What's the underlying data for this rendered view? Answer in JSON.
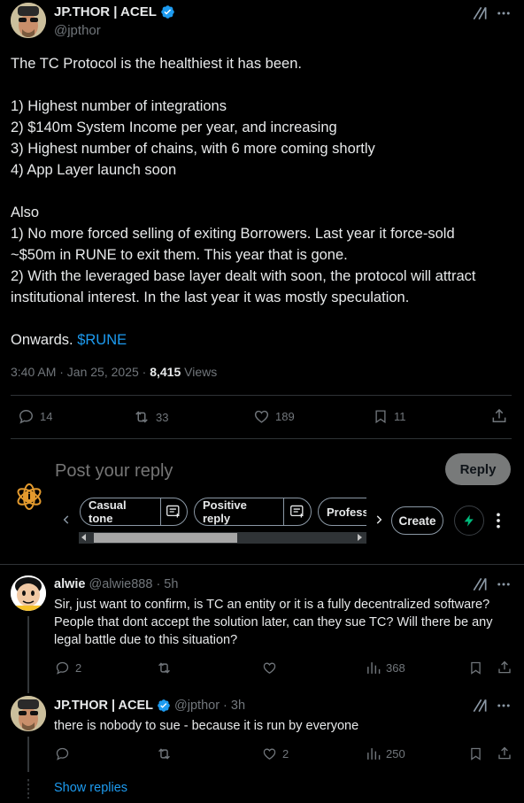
{
  "main_tweet": {
    "display_name": "JP.THOR | ACEL",
    "handle": "@jpthor",
    "lines": [
      "The TC Protocol is the healthiest it has been.",
      "",
      "1) Highest number of integrations",
      "2) $140m System Income per year, and increasing",
      "3) Highest number of chains, with 6 more coming shortly",
      "4) App Layer launch soon",
      "",
      "Also",
      "1) No more forced selling of exiting Borrowers. Last year it force-sold",
      "~$50m in RUNE to exit them. This year that is gone.",
      "2) With the leveraged base layer dealt with soon, the protocol will attract",
      "institutional interest. In the last year it was mostly speculation.",
      ""
    ],
    "final_line_prefix": "Onwards. ",
    "cashtag": "$RUNE",
    "timestamp": "3:40 AM · Jan 25, 2025 · ",
    "views_count": "8,415",
    "views_label": " Views",
    "replies": "14",
    "reposts": "33",
    "likes": "189",
    "bookmarks": "11"
  },
  "composer": {
    "placeholder": "Post your reply",
    "reply_button": "Reply",
    "suggestions": [
      "Casual tone",
      "Positive reply",
      "Profess"
    ],
    "create_button": "Create"
  },
  "replies": [
    {
      "display_name": "alwie",
      "handle": "@alwie888 · 5h",
      "text": "Sir, just want to confirm, is TC an entity or it is a fully decentralized software? People that dont accept the solution later, can they sue TC?  Will there be any legal battle due to this situation?",
      "replies": "2",
      "reposts": "",
      "likes": "",
      "views": "368"
    },
    {
      "display_name": "JP.THOR | ACEL",
      "handle": "@jpthor · 3h",
      "text": "there is nobody to sue - because it is run by everyone",
      "replies": "",
      "reposts": "",
      "likes": "2",
      "views": "250"
    }
  ],
  "show_replies": "Show replies",
  "colors": {
    "background": "#000000",
    "text": "#e7e9ea",
    "muted": "#71767b",
    "accent": "#1d9bf0",
    "divider": "#2f3336",
    "grok_green": "#00ba7c"
  },
  "icons": {
    "verified": "verified-badge-icon",
    "grok": "grok-icon",
    "more": "more-icon",
    "reply": "reply-icon",
    "repost": "repost-icon",
    "like": "like-icon",
    "bookmark": "bookmark-icon",
    "share": "share-icon",
    "views": "views-icon",
    "rewrite": "rewrite-icon"
  }
}
